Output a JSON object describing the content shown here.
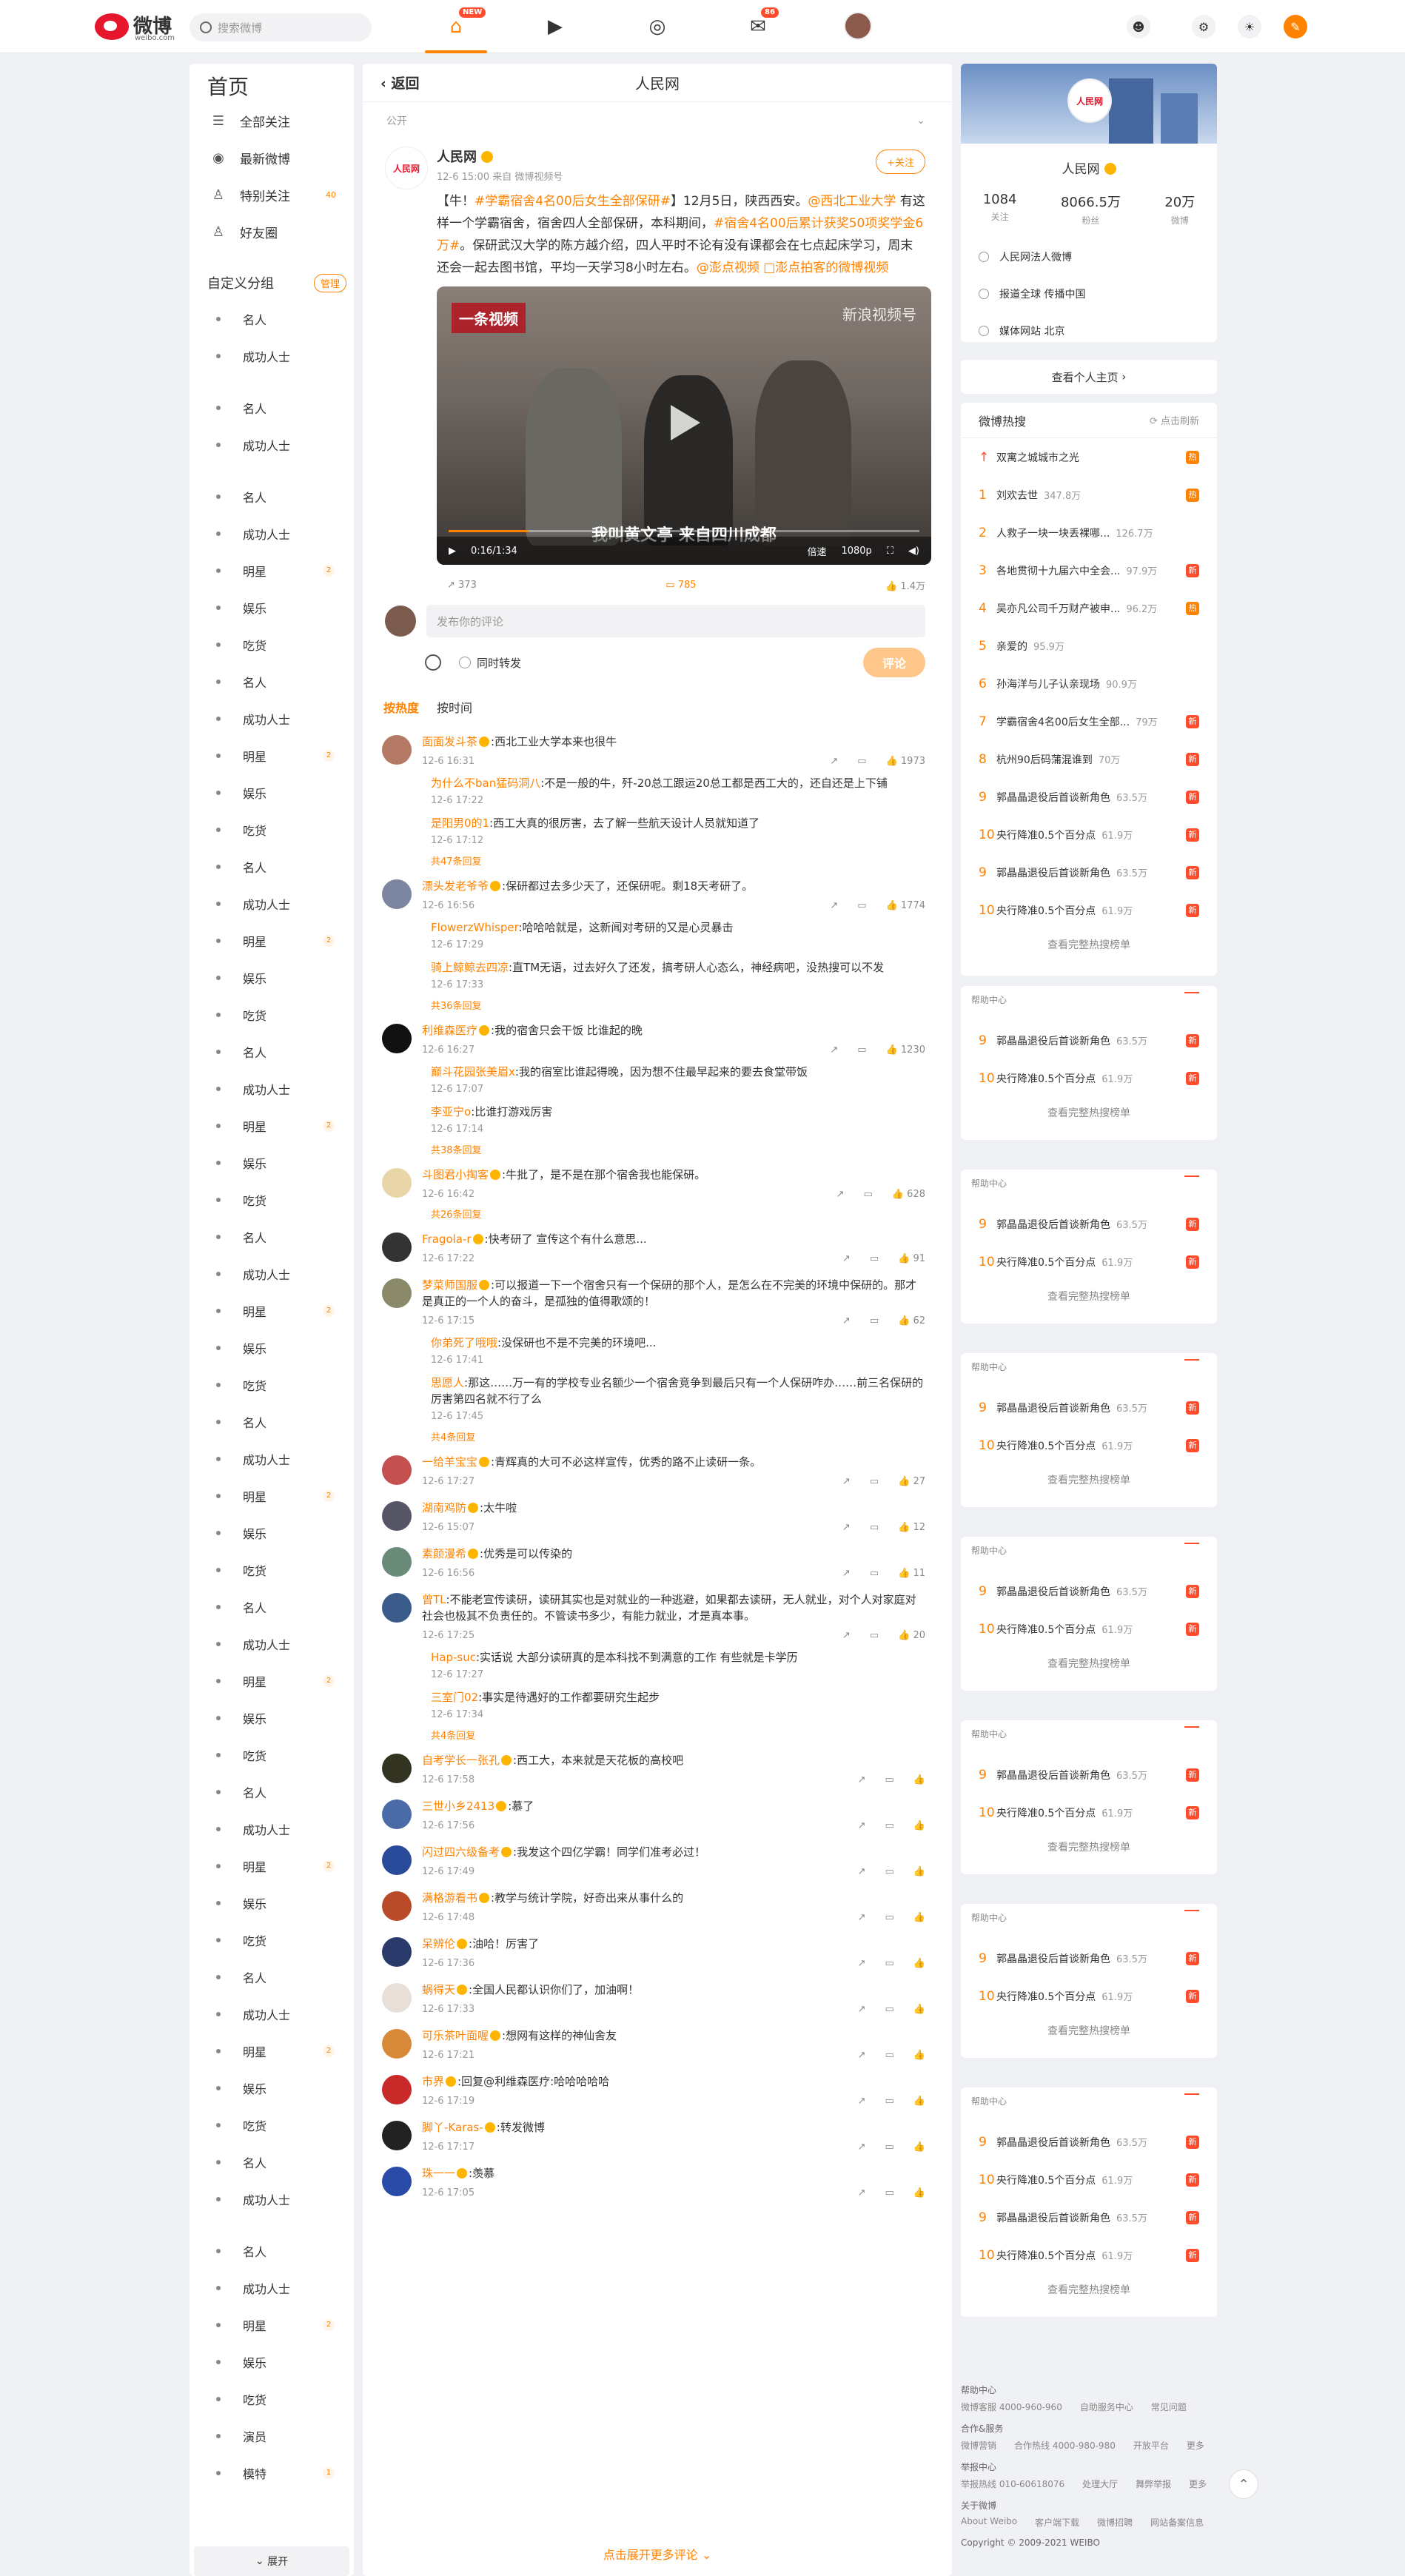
{
  "nav": {
    "logo_text": "微博",
    "logo_sub": "weibo.com",
    "search_placeholder": "搜索微博",
    "home_badge": "NEW",
    "msg_badge": "86"
  },
  "left": {
    "title": "首页",
    "items": [
      {
        "label": "全部关注",
        "icon": "list-icon"
      },
      {
        "label": "最新微博",
        "icon": "clock-icon"
      },
      {
        "label": "特别关注",
        "icon": "user-star-icon",
        "count": "40"
      },
      {
        "label": "好友圈",
        "icon": "users-icon"
      }
    ],
    "group_title": "自定义分组",
    "group_manage": "管理",
    "groups": [
      {
        "label": "名人"
      },
      {
        "label": "成功人士"
      },
      {
        "sep": true
      },
      {
        "label": "名人"
      },
      {
        "label": "成功人士"
      },
      {
        "sep": true
      },
      {
        "label": "名人"
      },
      {
        "label": "成功人士"
      },
      {
        "label": "明星",
        "badge": "2"
      },
      {
        "label": "娱乐"
      },
      {
        "label": "吃货"
      },
      {
        "label": "名人"
      },
      {
        "label": "成功人士"
      },
      {
        "label": "明星",
        "badge": "2"
      },
      {
        "label": "娱乐"
      },
      {
        "label": "吃货"
      },
      {
        "label": "名人"
      },
      {
        "label": "成功人士"
      },
      {
        "label": "明星",
        "badge": "2"
      },
      {
        "label": "娱乐"
      },
      {
        "label": "吃货"
      },
      {
        "label": "名人"
      },
      {
        "label": "成功人士"
      },
      {
        "label": "明星",
        "badge": "2"
      },
      {
        "label": "娱乐"
      },
      {
        "label": "吃货"
      },
      {
        "label": "名人"
      },
      {
        "label": "成功人士"
      },
      {
        "label": "明星",
        "badge": "2"
      },
      {
        "label": "娱乐"
      },
      {
        "label": "吃货"
      },
      {
        "label": "名人"
      },
      {
        "label": "成功人士"
      },
      {
        "label": "明星",
        "badge": "2"
      },
      {
        "label": "娱乐"
      },
      {
        "label": "吃货"
      },
      {
        "label": "名人"
      },
      {
        "label": "成功人士"
      },
      {
        "label": "明星",
        "badge": "2"
      },
      {
        "label": "娱乐"
      },
      {
        "label": "吃货"
      },
      {
        "label": "名人"
      },
      {
        "label": "成功人士"
      },
      {
        "label": "明星",
        "badge": "2"
      },
      {
        "label": "娱乐"
      },
      {
        "label": "吃货"
      },
      {
        "label": "名人"
      },
      {
        "label": "成功人士"
      },
      {
        "label": "明星",
        "badge": "2"
      },
      {
        "label": "娱乐"
      },
      {
        "label": "吃货"
      },
      {
        "label": "名人"
      },
      {
        "label": "成功人士"
      },
      {
        "sep": true
      },
      {
        "label": "名人"
      },
      {
        "label": "成功人士"
      },
      {
        "label": "明星",
        "badge": "2"
      },
      {
        "label": "娱乐"
      },
      {
        "label": "吃货"
      },
      {
        "label": "演员"
      },
      {
        "label": "模特",
        "badge": "1"
      }
    ],
    "expand": "展开"
  },
  "main": {
    "back": "返回",
    "title": "人民网",
    "visibility": "公开",
    "post": {
      "name": "人民网",
      "meta": "12-6 15:00 来自 微博视频号",
      "follow": "+关注",
      "text_parts": [
        {
          "t": "【牛！"
        },
        {
          "t": "#学霸宿舍4名00后女生全部保研#",
          "hl": true
        },
        {
          "t": "】12月5日，陕西西安。"
        },
        {
          "t": "@西北工业大学",
          "hl": true
        },
        {
          "t": " 有这样一个学霸宿舍，宿舍四人全部保研，本科期间，"
        },
        {
          "t": "#宿舍4名00后累计获奖50项奖学金6万#",
          "hl": true
        },
        {
          "t": "。保研武汉大学的陈方越介绍，四人平时不论有没有课都会在七点起床学习，周末还会一起去图书馆，平均一天学习8小时左右。"
        },
        {
          "t": "@澎点视频",
          "hl": true
        },
        {
          "t": " "
        },
        {
          "t": "□澎点拍客的微博视频",
          "hl": true
        }
      ],
      "video": {
        "title": "一条视频",
        "watermark": "新浪视频号",
        "subtitle": "我叫黄文亭 来自四川成都",
        "time": "0:16/1:34",
        "speed": "倍速",
        "quality": "1080p",
        "progress": 0.17
      },
      "stats": {
        "share": "373",
        "comment": "785",
        "like": "1.4万"
      }
    },
    "comment_placeholder": "发布你的评论",
    "repost_label": "同时转发",
    "publish": "评论",
    "tabs": [
      "按热度",
      "按时间"
    ],
    "comments": [
      {
        "name": "面面发斗茶",
        "badge": true,
        "text": ":西北工业大学本来也很牛",
        "time": "12-6 16:31",
        "likes": "1973",
        "avc": "#b57a66",
        "replies": [
          {
            "name": "为什么不ban猛码洞八",
            "text": ":不是一般的牛，歼-20总工跟运20总工都是西工大的，还自还是上下铺",
            "time": "12-6 17:22"
          },
          {
            "name": "是阳男0的1",
            "text": ":西工大真的很厉害，去了解一些航天设计人员就知道了",
            "time": "12-6 17:12"
          }
        ],
        "more": "共47条回复"
      },
      {
        "name": "漂头发老爷爷",
        "badge": true,
        "text": ":保研都过去多少天了，还保研呢。剩18天考研了。",
        "time": "12-6 16:56",
        "likes": "1774",
        "avc": "#7d86a0",
        "replies": [
          {
            "name": "FlowerzWhisper",
            "text": ":哈哈哈就是，这新闻对考研的又是心灵暴击",
            "time": "12-6 17:29"
          },
          {
            "name": "骑上鲸鲸去四凉",
            "text": ":直TM无语，过去好久了还发，搞考研人心态么，神经病吧，没热搜可以不发",
            "time": "12-6 17:33"
          }
        ],
        "more": "共36条回复"
      },
      {
        "name": "利维森医疗",
        "badge": true,
        "text": ":我的宿舍只会干饭 比谁起的晚",
        "time": "12-6 16:27",
        "likes": "1230",
        "avc": "#111",
        "replies": [
          {
            "name": "巅斗花园张美眉x",
            "text": ":我的宿室比谁起得晚，因为想不住最早起来的要去食堂带饭",
            "time": "12-6 17:07"
          },
          {
            "name": "李亚宁o",
            "text": ":比谁打游戏厉害",
            "time": "12-6 17:14"
          }
        ],
        "more": "共38条回复"
      },
      {
        "name": "斗图君小掏客",
        "badge": true,
        "text": ":牛批了，是不是在那个宿舍我也能保研。",
        "time": "12-6 16:42",
        "likes": "628",
        "avc": "#e8d6a8",
        "replies": [],
        "more": "共26条回复"
      },
      {
        "name": "Fragola-r",
        "badge": true,
        "text": ":快考研了 宣传这个有什么意思...",
        "time": "12-6 17:22",
        "likes": "91",
        "avc": "#333",
        "replies": [],
        "more": ""
      },
      {
        "name": "梦菜师国服",
        "badge": true,
        "text": ":可以报道一下一个宿舍只有一个保研的那个人，是怎么在不完美的环境中保研的。那才是真正的一个人的奋斗，是孤独的值得歌颂的！",
        "time": "12-6 17:15",
        "likes": "62",
        "avc": "#8a8a6a",
        "replies": [
          {
            "name": "你弟死了哦哦",
            "text": ":没保研也不是不完美的环境吧...",
            "time": "12-6 17:41"
          },
          {
            "name": "思愿人",
            "text": ":那这……万一有的学校专业名额少一个宿舍竞争到最后只有一个人保研咋办……前三名保研的厉害第四名就不行了么",
            "time": "12-6 17:45"
          }
        ],
        "more": "共4条回复"
      },
      {
        "name": "一给羊宝宝",
        "badge": true,
        "text": ":青辉真的大可不必这样宣传，优秀的路不止读研一条。",
        "time": "12-6 17:27",
        "likes": "27",
        "avc": "#c45050",
        "replies": [],
        "more": ""
      },
      {
        "name": "湖南鸡防",
        "badge": true,
        "text": ":太牛啦",
        "time": "12-6 15:07",
        "likes": "12",
        "avc": "#556",
        "replies": [],
        "more": ""
      },
      {
        "name": "素颜漫希",
        "badge": true,
        "text": ":优秀是可以传染的",
        "time": "12-6 16:56",
        "likes": "11",
        "avc": "#6a8a7a",
        "replies": [],
        "more": ""
      },
      {
        "name": "曾TL",
        "badge": false,
        "text": ":不能老宣传读研，读研其实也是对就业的一种逃避，如果都去读研，无人就业，对个人对家庭对社会也极其不负责任的。不管读书多少，有能力就业，才是真本事。",
        "time": "12-6 17:25",
        "likes": "20",
        "avc": "#3b5b8a",
        "replies": [
          {
            "name": "Hap-suc",
            "text": ":实话说 大部分读研真的是本科找不到满意的工作 有些就是卡学历",
            "time": "12-6 17:27"
          },
          {
            "name": "三室门02",
            "text": ":事实是待遇好的工作都要研究生起步",
            "time": "12-6 17:34"
          }
        ],
        "more": "共4条回复"
      },
      {
        "name": "自考学长一张孔",
        "badge": true,
        "text": ":西工大，本来就是天花板的高校吧",
        "time": "12-6 17:58",
        "likes": "",
        "avc": "#332",
        "replies": [],
        "more": ""
      },
      {
        "name": "三世小乡2413",
        "badge": true,
        "text": ":慕了",
        "time": "12-6 17:56",
        "likes": "",
        "avc": "#4a6aa8",
        "replies": [],
        "more": ""
      },
      {
        "name": "闪过四六级备考",
        "badge": true,
        "text": ":我发这个四亿学霸！同学们准考必过！",
        "time": "12-6 17:49",
        "likes": "",
        "avc": "#2a4a9a",
        "replies": [],
        "more": ""
      },
      {
        "name": "满格游看书",
        "badge": true,
        "text": ":教学与统计学院，好奇出来从事什么的",
        "time": "12-6 17:48",
        "likes": "",
        "avc": "#b84a2a",
        "replies": [],
        "more": ""
      },
      {
        "name": "呆辨伦",
        "badge": true,
        "text": ":油哈！厉害了",
        "time": "12-6 17:36",
        "likes": "",
        "avc": "#2a3a6a",
        "replies": [],
        "more": ""
      },
      {
        "name": "蜗得天",
        "badge": true,
        "text": ":全国人民都认识你们了，加油啊！",
        "time": "12-6 17:33",
        "likes": "",
        "avc": "#e8e0d8",
        "replies": [],
        "more": ""
      },
      {
        "name": "可乐茶叶面喔",
        "badge": true,
        "text": ":想网有这样的神仙舍友",
        "time": "12-6 17:21",
        "likes": "",
        "avc": "#d88a3a",
        "replies": [],
        "more": ""
      },
      {
        "name": "市界",
        "badge": true,
        "text": ":回复@利维森医疗:哈哈哈哈哈",
        "time": "12-6 17:19",
        "likes": "",
        "avc": "#c82a2a",
        "replies": [],
        "more": ""
      },
      {
        "name": "脚丫-Karas-",
        "badge": true,
        "text": ":转发微博",
        "time": "12-6 17:17",
        "likes": "",
        "avc": "#222",
        "replies": [],
        "more": ""
      },
      {
        "name": "珠一一",
        "badge": true,
        "text": ":羡慕",
        "time": "12-6 17:05",
        "likes": "",
        "avc": "#2a4aa8",
        "replies": [],
        "more": ""
      }
    ],
    "load_more": "点击展开更多评论"
  },
  "right": {
    "profile": {
      "name": "人民网",
      "stats": [
        {
          "v": "1084",
          "l": "关注"
        },
        {
          "v": "8066.5万",
          "l": "粉丝"
        },
        {
          "v": "20万",
          "l": "微博"
        }
      ],
      "info": [
        "人民网法人微博",
        "报道全球 传播中国",
        "媒体网站 北京"
      ],
      "home_link": "查看个人主页"
    },
    "hot_title": "微博热搜",
    "refresh": "点击刷新",
    "hot": [
      {
        "rank": "",
        "text": "双寓之城城市之光",
        "count": "",
        "tag": "热",
        "top": true
      },
      {
        "rank": "1",
        "text": "刘欢去世",
        "count": "347.8万",
        "tag": "热"
      },
      {
        "rank": "2",
        "text": "人救子一块一块丢裸哪...",
        "count": "126.7万",
        "tag": ""
      },
      {
        "rank": "3",
        "text": "各地贯彻十九届六中全会...",
        "count": "97.9万",
        "tag": "新"
      },
      {
        "rank": "4",
        "text": "吴亦凡公司千万财产被申...",
        "count": "96.2万",
        "tag": "热"
      },
      {
        "rank": "5",
        "text": "亲爱的",
        "count": "95.9万",
        "tag": ""
      },
      {
        "rank": "6",
        "text": "孙海洋与儿子认亲现场",
        "count": "90.9万",
        "tag": ""
      },
      {
        "rank": "7",
        "text": "学霸宿舍4名00后女生全部...",
        "count": "79万",
        "tag": "新"
      },
      {
        "rank": "8",
        "text": "杭州90后码蒲混谁到",
        "count": "70万",
        "tag": "新"
      },
      {
        "rank": "9",
        "text": "郭晶晶退役后首谈新角色",
        "count": "63.5万",
        "tag": "新"
      },
      {
        "rank": "10",
        "text": "央行降准0.5个百分点",
        "count": "61.9万",
        "tag": "新"
      },
      {
        "rank": "9",
        "text": "郭晶晶退役后首谈新角色",
        "count": "63.5万",
        "tag": "新"
      },
      {
        "rank": "10",
        "text": "央行降准0.5个百分点",
        "count": "61.9万",
        "tag": "新"
      }
    ],
    "hot_more": "查看完整热搜榜单",
    "small_boxes": [
      {
        "head": "帮助中心"
      },
      {
        "head": "帮助中心"
      },
      {
        "head": "帮助中心"
      },
      {
        "head": "帮助中心"
      },
      {
        "head": "帮助中心"
      }
    ],
    "small_items": [
      {
        "rank": "9",
        "text": "郭晶晶退役后首谈新角色",
        "count": "63.5万",
        "tag": "新"
      },
      {
        "rank": "10",
        "text": "央行降准0.5个百分点",
        "count": "61.9万",
        "tag": "新"
      }
    ],
    "big_items": [
      {
        "rank": "9",
        "text": "郭晶晶退役后首谈新角色",
        "count": "63.5万",
        "tag": "新"
      },
      {
        "rank": "10",
        "text": "央行降准0.5个百分点",
        "count": "61.9万",
        "tag": "新"
      },
      {
        "rank": "9",
        "text": "郭晶晶退役后首谈新角色",
        "count": "63.5万",
        "tag": "新"
      },
      {
        "rank": "10",
        "text": "央行降准0.5个百分点",
        "count": "61.9万",
        "tag": "新"
      }
    ],
    "footer": [
      {
        "h": "帮助中心",
        "links": [
          "微博客服 4000-960-960",
          "自助服务中心",
          "常见问题"
        ]
      },
      {
        "h": "合作&服务",
        "links": [
          "微博营销",
          "合作热线 4000-980-980",
          "开放平台",
          "更多"
        ]
      },
      {
        "h": "举报中心",
        "links": [
          "举报热线 010-60618076",
          "处理大厅",
          "舞弊举报",
          "更多"
        ]
      },
      {
        "h": "关于微博",
        "links": [
          "About Weibo",
          "客户端下载",
          "微博招聘",
          "网站备案信息"
        ]
      }
    ],
    "copyright": "Copyright © 2009-2021 WEIBO"
  }
}
